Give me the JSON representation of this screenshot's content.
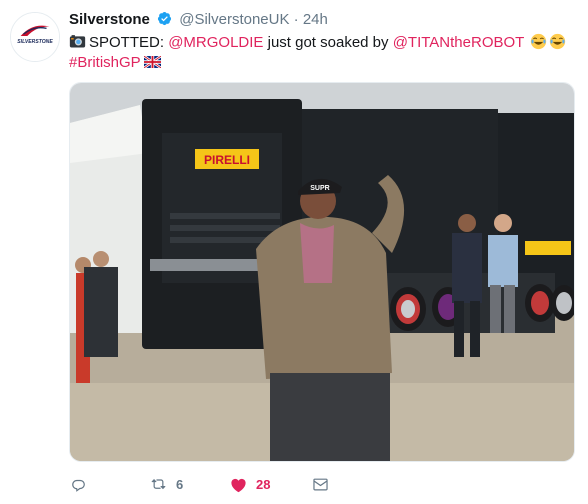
{
  "tweet": {
    "display_name": "Silverstone",
    "handle": "@SilverstoneUK",
    "separator": "·",
    "time": "24h",
    "avatar_text": "SILVERSTONE",
    "text_parts": {
      "t1": "SPOTTED: ",
      "mention1": "@MRGOLDIE",
      "t2": " just got soaked by ",
      "mention2": "@TITANtheROBOT",
      "hashtag": "#BritishGP"
    },
    "image_signage": {
      "brand": "PIRELLI",
      "cap": "SUPR"
    }
  },
  "actions": {
    "reply_count": "",
    "retweet_count": "6",
    "like_count": "28",
    "dm_count": ""
  },
  "colors": {
    "accent": "#e0245e",
    "verified": "#1da1f2",
    "muted": "#657786"
  },
  "icons": [
    "verified-badge-icon",
    "camera-icon",
    "laughing-emoji-icon",
    "uk-flag-icon",
    "reply-icon",
    "retweet-icon",
    "heart-icon",
    "mail-icon"
  ]
}
